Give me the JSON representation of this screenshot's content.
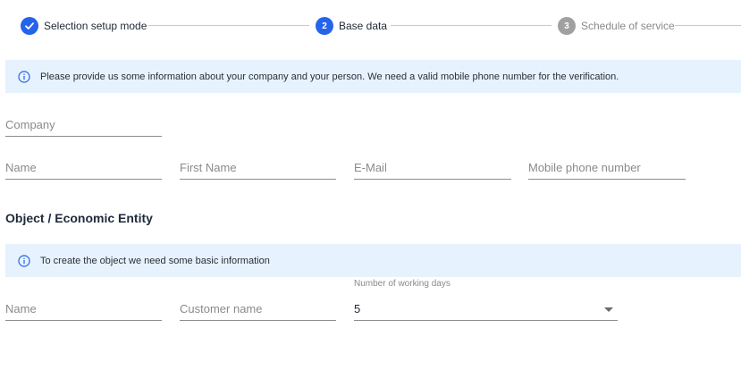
{
  "stepper": {
    "steps": [
      {
        "number": "",
        "label": "Selection setup mode",
        "state": "done"
      },
      {
        "number": "2",
        "label": "Base data",
        "state": "active"
      },
      {
        "number": "3",
        "label": "Schedule of service",
        "state": "future"
      }
    ]
  },
  "info_banner_1": {
    "text": "Please provide us some information about your company and your person. We need a valid mobile phone number for the verification."
  },
  "base_fields": {
    "company": {
      "placeholder": "Company"
    },
    "name": {
      "placeholder": "Name"
    },
    "first_name": {
      "placeholder": "First Name"
    },
    "email": {
      "placeholder": "E-Mail"
    },
    "mobile": {
      "placeholder": "Mobile phone number"
    }
  },
  "object_section": {
    "title": "Object / Economic Entity",
    "info_text": "To create the object we need some basic information",
    "name": {
      "placeholder": "Name"
    },
    "customer_name": {
      "placeholder": "Customer name"
    },
    "working_days": {
      "label": "Number of working days",
      "value": "5"
    }
  },
  "colors": {
    "accent": "#2563eb",
    "info_bg": "#e6f2fd",
    "inactive": "#a0a0a0"
  }
}
